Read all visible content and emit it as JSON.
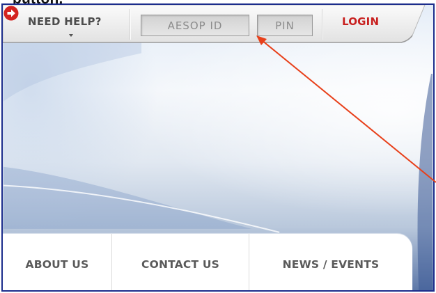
{
  "caption_fragment": "button.",
  "header": {
    "need_help_label": "NEED HELP?",
    "aesop_id": {
      "placeholder": "AESOP ID",
      "value": ""
    },
    "pin": {
      "placeholder": "PIN",
      "value": ""
    },
    "login_label": "LOGIN",
    "login_icon": "arrow-right-circle-icon"
  },
  "nav": {
    "tabs": [
      {
        "label": "ABOUT US"
      },
      {
        "label": "CONTACT US"
      },
      {
        "label": "NEWS / EVENTS"
      }
    ]
  },
  "annotation": {
    "arrow_color": "#e8401a",
    "target": "pin-field"
  },
  "colors": {
    "frame_border": "#1c2d8c",
    "login_red": "#c8201f",
    "nav_text": "#5a5a5a"
  }
}
